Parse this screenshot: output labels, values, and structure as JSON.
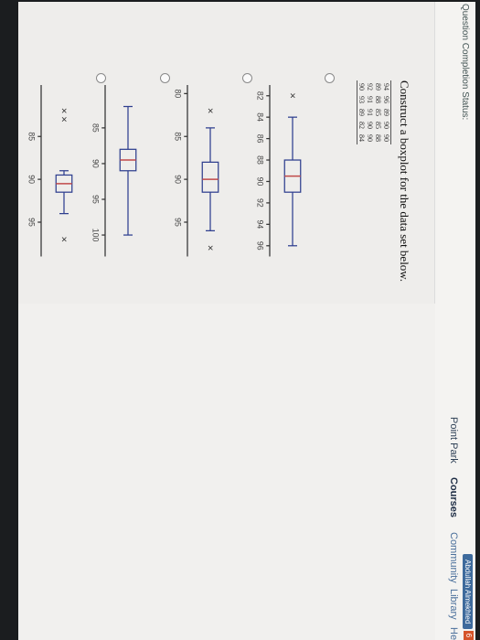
{
  "header": {
    "question_status": "Question Completion Status:",
    "brand": "Point Park",
    "nav": [
      "Courses",
      "Community",
      "Library",
      "Help"
    ],
    "active_nav": "Courses",
    "user_tag": "Abdullah Almekhled",
    "notification_count": "6"
  },
  "question": {
    "instruction": "Construct a boxplot for the data set below.",
    "data_rows": [
      [
        "94",
        "96",
        "89",
        "90",
        "90"
      ],
      [
        "89",
        "88",
        "85",
        "85",
        "88"
      ],
      [
        "92",
        "91",
        "91",
        "90",
        "90"
      ],
      [
        "90",
        "93",
        "89",
        "82",
        "84"
      ]
    ]
  },
  "chart_data": [
    {
      "type": "boxplot",
      "option": 1,
      "xlim": [
        81,
        97
      ],
      "ticks": [
        82,
        84,
        86,
        88,
        90,
        92,
        94,
        96
      ],
      "min": 84,
      "q1": 88,
      "median": 89.5,
      "q3": 91,
      "max": 96,
      "outliers": [
        82
      ]
    },
    {
      "type": "boxplot",
      "option": 2,
      "xlim": [
        79,
        99
      ],
      "ticks": [
        80,
        85,
        90,
        95
      ],
      "min": 84,
      "q1": 88,
      "median": 90,
      "q3": 91.5,
      "max": 96,
      "outliers": [
        82,
        98
      ]
    },
    {
      "type": "boxplot",
      "option": 3,
      "xlim": [
        79,
        103
      ],
      "ticks": [
        85,
        90,
        95,
        100
      ],
      "min": 82,
      "q1": 88,
      "median": 89.5,
      "q3": 91,
      "max": 100,
      "outliers": []
    },
    {
      "type": "boxplot",
      "option": 4,
      "xlim": [
        79,
        99
      ],
      "ticks": [
        85,
        90,
        95
      ],
      "min": 89,
      "q1": 89.5,
      "median": 90.5,
      "q3": 91.5,
      "max": 94,
      "outliers": [
        82,
        83,
        97
      ]
    }
  ]
}
